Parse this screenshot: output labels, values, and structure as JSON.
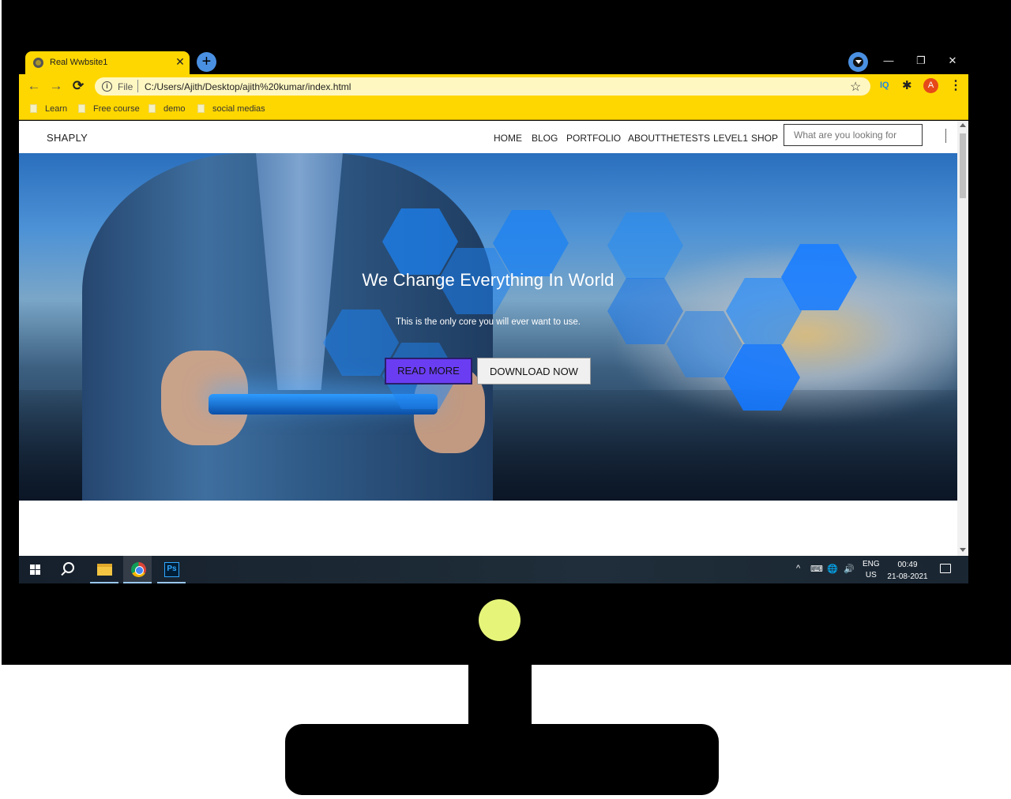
{
  "browser": {
    "tab": {
      "title": "Real Wwbsite1",
      "close_glyph": "✕"
    },
    "new_tab_glyph": "+",
    "window_controls": {
      "minimize": "—",
      "restore": "❐",
      "close": "✕"
    },
    "address": {
      "scheme_label": "File",
      "url": "C:/Users/Ajith/Desktop/ajith%20kumar/index.html"
    },
    "nav": {
      "back": "←",
      "forward": "→",
      "reload": "⟳"
    },
    "extensions": {
      "iq": "IQ",
      "puzzle": "✱",
      "avatar_letter": "A",
      "menu": "⋮",
      "star": "☆"
    },
    "bookmarks": [
      "Learn",
      "Free course",
      "demo",
      "social medias"
    ]
  },
  "site": {
    "brand": "SHAPLY",
    "menu": [
      "HOME",
      "BLOG",
      "PORTFOLIO",
      "ABOUTTHETESTS",
      "LEVEL1",
      "SHOP"
    ],
    "search_placeholder": "What are you looking for",
    "hero": {
      "title": "We Change Everything In World",
      "subtitle": "This is the only core you will ever want to use.",
      "primary_button": "READ MORE",
      "secondary_button": "DOWNLOAD NOW"
    }
  },
  "taskbar": {
    "lang_line1": "ENG",
    "lang_line2": "US",
    "time": "00:49",
    "date": "21-08-2021",
    "tray_icons": [
      "^",
      "⌨",
      "🌐",
      "🔊"
    ]
  },
  "colors": {
    "browser_accent": "#ffd700",
    "primary_button": "#6a3df2",
    "power_led": "#e6f57a"
  }
}
